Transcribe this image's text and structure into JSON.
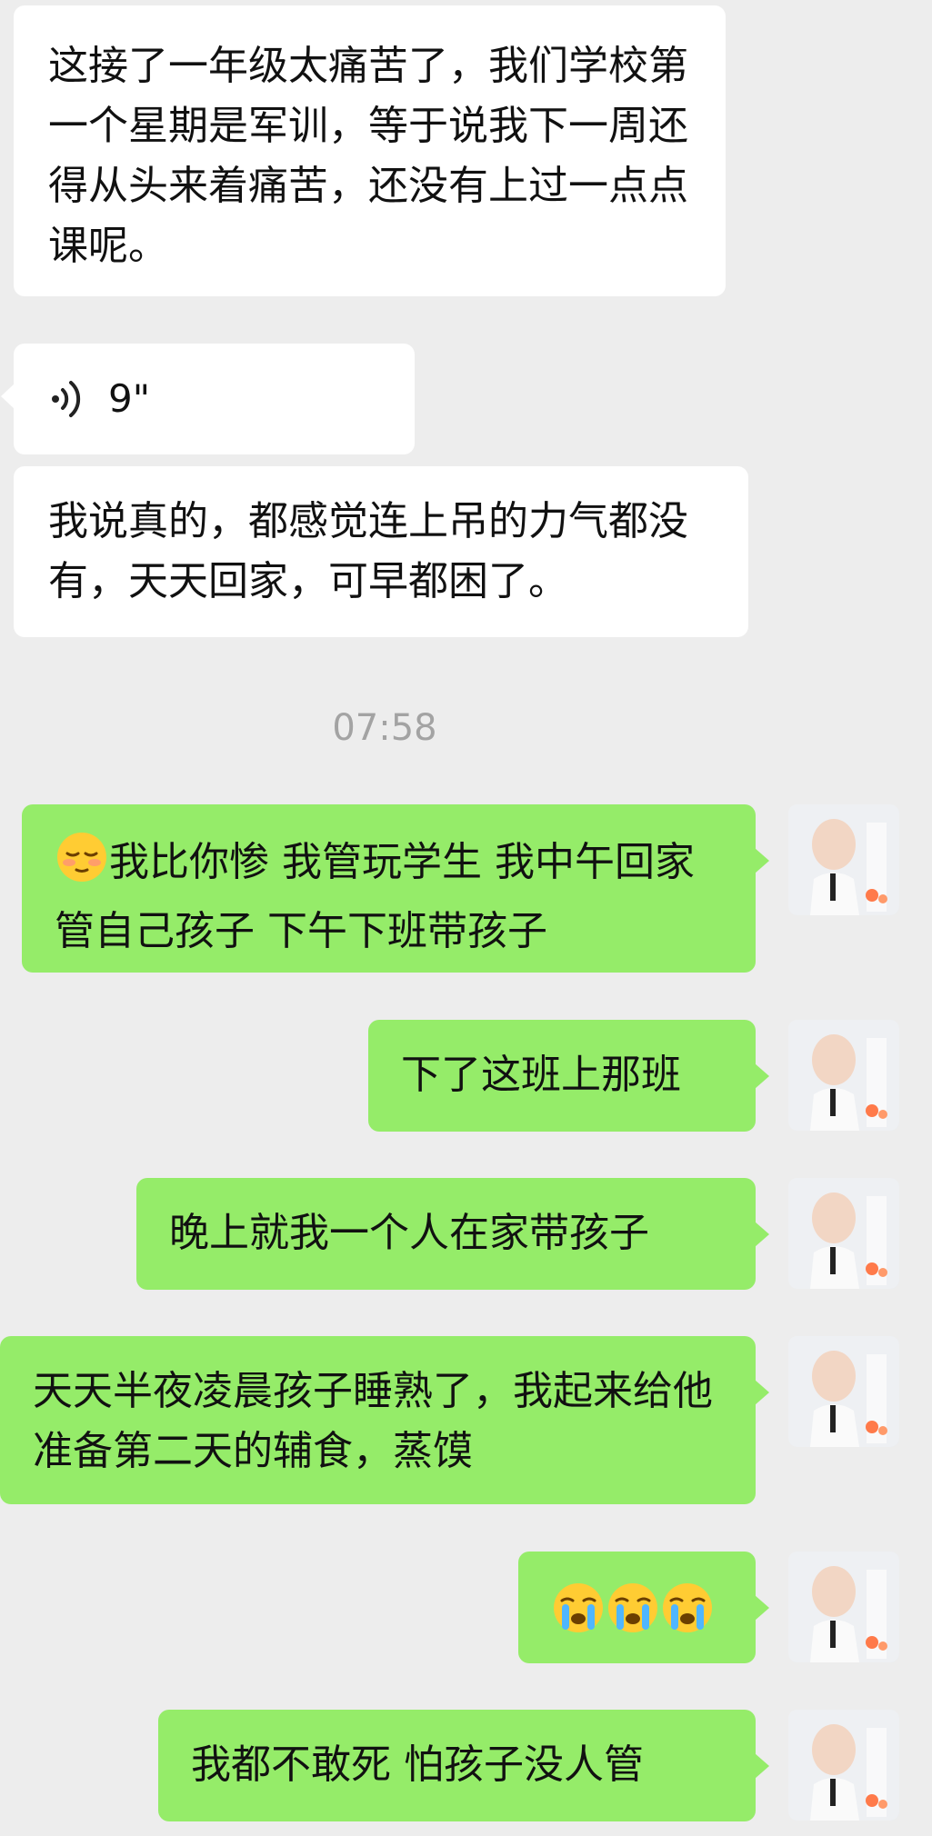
{
  "incoming": {
    "msg1": "这接了一年级太痛苦了，我们学校第一个星期是军训，等于说我下一周还得从头来着痛苦，还没有上过一点点课呢。",
    "voice_duration": "9\"",
    "msg2": "我说真的，都感觉连上吊的力气都没有，天天回家，可早都困了。"
  },
  "timestamp": "07:58",
  "outgoing": {
    "msg1_emoji": "pensive-relieved-face-emoji",
    "msg1_text": "我比你惨  我管玩学生  我中午回家管自己孩子  下午下班带孩子",
    "msg2": "下了这班上那班",
    "msg3": "晚上就我一个人在家带孩子",
    "msg4": "天天半夜凌晨孩子睡熟了，我起来给他准备第二天的辅食，蒸馍",
    "msg5_emoji": [
      "crying-face-emoji",
      "crying-face-emoji",
      "crying-face-emoji"
    ],
    "msg6": "我都不敢死  怕孩子没人管"
  },
  "colors": {
    "background": "#ededed",
    "incoming_bubble": "#ffffff",
    "outgoing_bubble": "#95ec69",
    "timestamp": "#a3a3a3"
  }
}
